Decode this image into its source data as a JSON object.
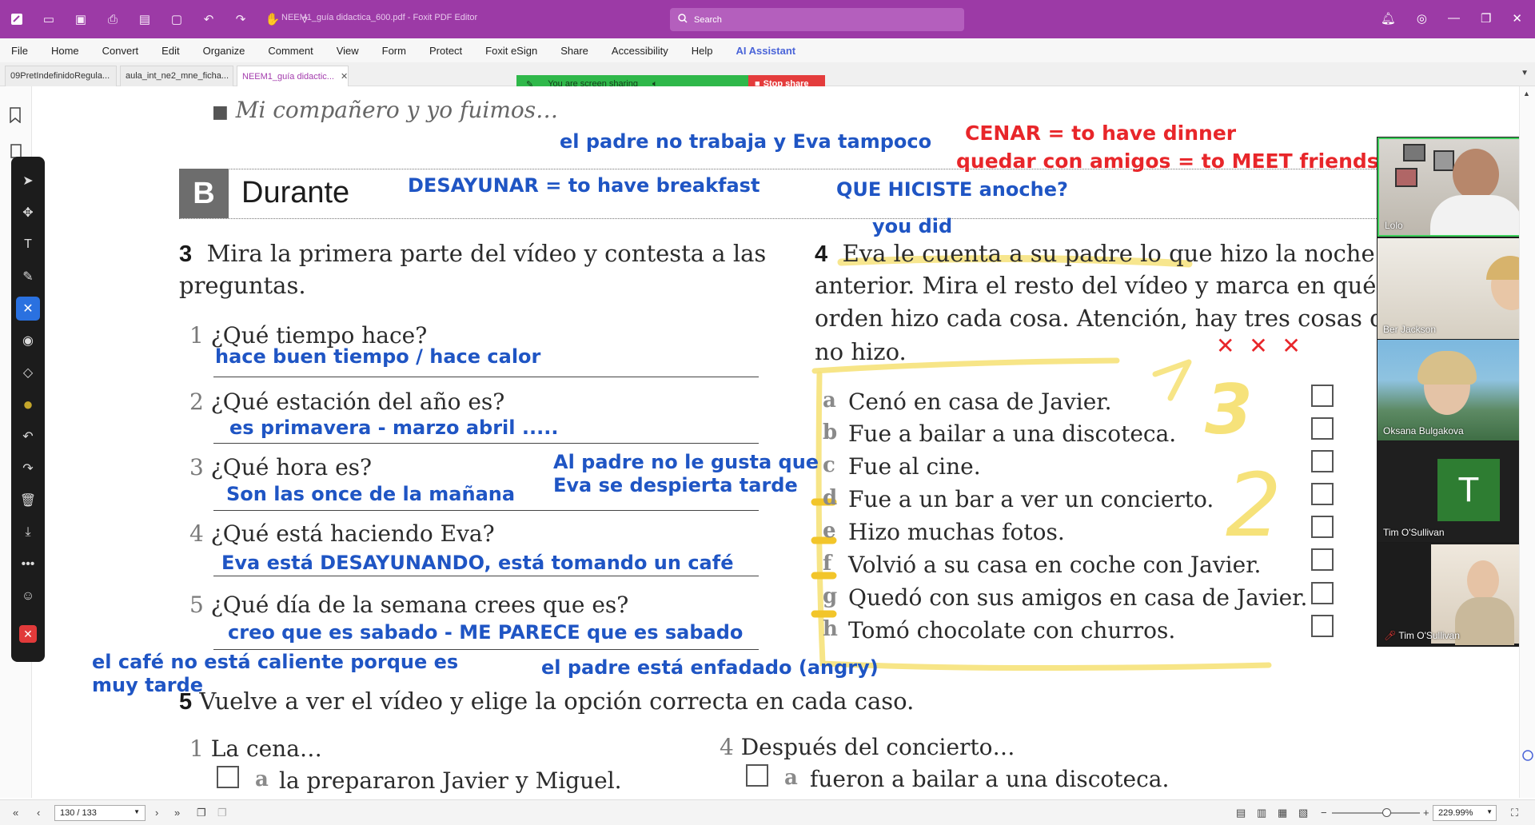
{
  "app": {
    "doc_title": "NEEM1_guía didactica_600.pdf - Foxit PDF Editor",
    "search_placeholder": "Search"
  },
  "menu": [
    "File",
    "Home",
    "Convert",
    "Edit",
    "Organize",
    "Comment",
    "View",
    "Form",
    "Protect",
    "Foxit eSign",
    "Share",
    "Accessibility",
    "Help",
    "AI Assistant"
  ],
  "tabs": [
    {
      "label": "09PretIndefinidoRegula..."
    },
    {
      "label": "aula_int_ne2_mne_ficha..."
    },
    {
      "label": "NEEM1_guía didactic..."
    }
  ],
  "share_banner": {
    "text": "You are screen sharing",
    "stop": "Stop share"
  },
  "document": {
    "prev_item": "Mi compañero y yo fuimos…",
    "section_letter": "B",
    "section_title": "Durante",
    "ex3_num": "3",
    "ex3_text1": "Mira la primera parte del vídeo y contesta a las",
    "ex3_text2": "preguntas.",
    "questions": [
      {
        "n": "1",
        "q": "¿Qué tiempo hace?"
      },
      {
        "n": "2",
        "q": "¿Qué estación del año es?"
      },
      {
        "n": "3",
        "q": "¿Qué hora es?"
      },
      {
        "n": "4",
        "q": "¿Qué está haciendo Eva?"
      },
      {
        "n": "5",
        "q": "¿Qué día de la semana crees que es?"
      }
    ],
    "ex4_num": "4",
    "ex4_lines": [
      "Eva le cuenta a su padre lo que hizo la noche",
      "anterior. Mira el resto del vídeo y marca en qué",
      "orden hizo cada cosa. Atención, hay tres cosas que",
      "no hizo."
    ],
    "options": [
      {
        "l": "a",
        "t": "Cenó en casa de Javier."
      },
      {
        "l": "b",
        "t": "Fue a bailar a una discoteca."
      },
      {
        "l": "c",
        "t": "Fue al cine."
      },
      {
        "l": "d",
        "t": "Fue a un bar a ver un concierto."
      },
      {
        "l": "e",
        "t": "Hizo muchas fotos."
      },
      {
        "l": "f",
        "t": "Volvió a su casa en coche con Javier."
      },
      {
        "l": "g",
        "t": "Quedó con sus amigos en casa de Javier."
      },
      {
        "l": "h",
        "t": "Tomó chocolate con churros."
      }
    ],
    "ex5_num": "5",
    "ex5_text": "Vuelve a ver el vídeo y elige la opción correcta en cada caso.",
    "ex5_q1_n": "1",
    "ex5_q1": "La cena…",
    "ex5_q1_a_letter": "a",
    "ex5_q1_a": "la prepararon Javier y Miguel.",
    "ex5_q4_n": "4",
    "ex5_q4": "Después del concierto…",
    "ex5_q4_a_letter": "a",
    "ex5_q4_a": "fueron a bailar a una discoteca."
  },
  "annotations": {
    "padre_no_trabaja": "el padre no trabaja y Eva tampoco",
    "cenar": "CENAR = to have dinner",
    "quedar": "quedar con amigos = to MEET friends",
    "desayunar": "DESAYUNAR = to have breakfast",
    "que_hiciste": "QUE HICISTE anoche?",
    "you_did": "you did",
    "a1": "hace buen tiempo / hace calor",
    "a2": "es primavera -  marzo abril .....",
    "a3": "Son las once de la mañana",
    "padre_gusta_1": "Al padre no le gusta que",
    "padre_gusta_2": "Eva se despierta tarde",
    "a4": "Eva está DESAYUNANDO, está tomando un café",
    "a5": "creo que es sabado - ME PARECE que es sabado",
    "cafe_1": "el café no está caliente porque es",
    "cafe_2": "muy tarde",
    "enfadado": "el padre está enfadado (angry)",
    "crosses": "✕ ✕ ✕",
    "hand_3": "3",
    "hand_2": "2"
  },
  "participants": [
    {
      "name": "Lolo"
    },
    {
      "name": "Ber Jackson"
    },
    {
      "name": "Oksana Bulgakova"
    },
    {
      "name": "Tim O'Sullivan",
      "initial": "T"
    },
    {
      "name": "Tim O'Sullivan"
    }
  ],
  "status": {
    "page": "130 / 133",
    "zoom": "229.99%",
    "zoom_level_percent": 62
  },
  "colors": {
    "titlebar": "#9c3aa6",
    "annotation_blue": "#1f55c4",
    "annotation_red": "#e8262a",
    "highlight_yellow": "#f6e27a"
  }
}
